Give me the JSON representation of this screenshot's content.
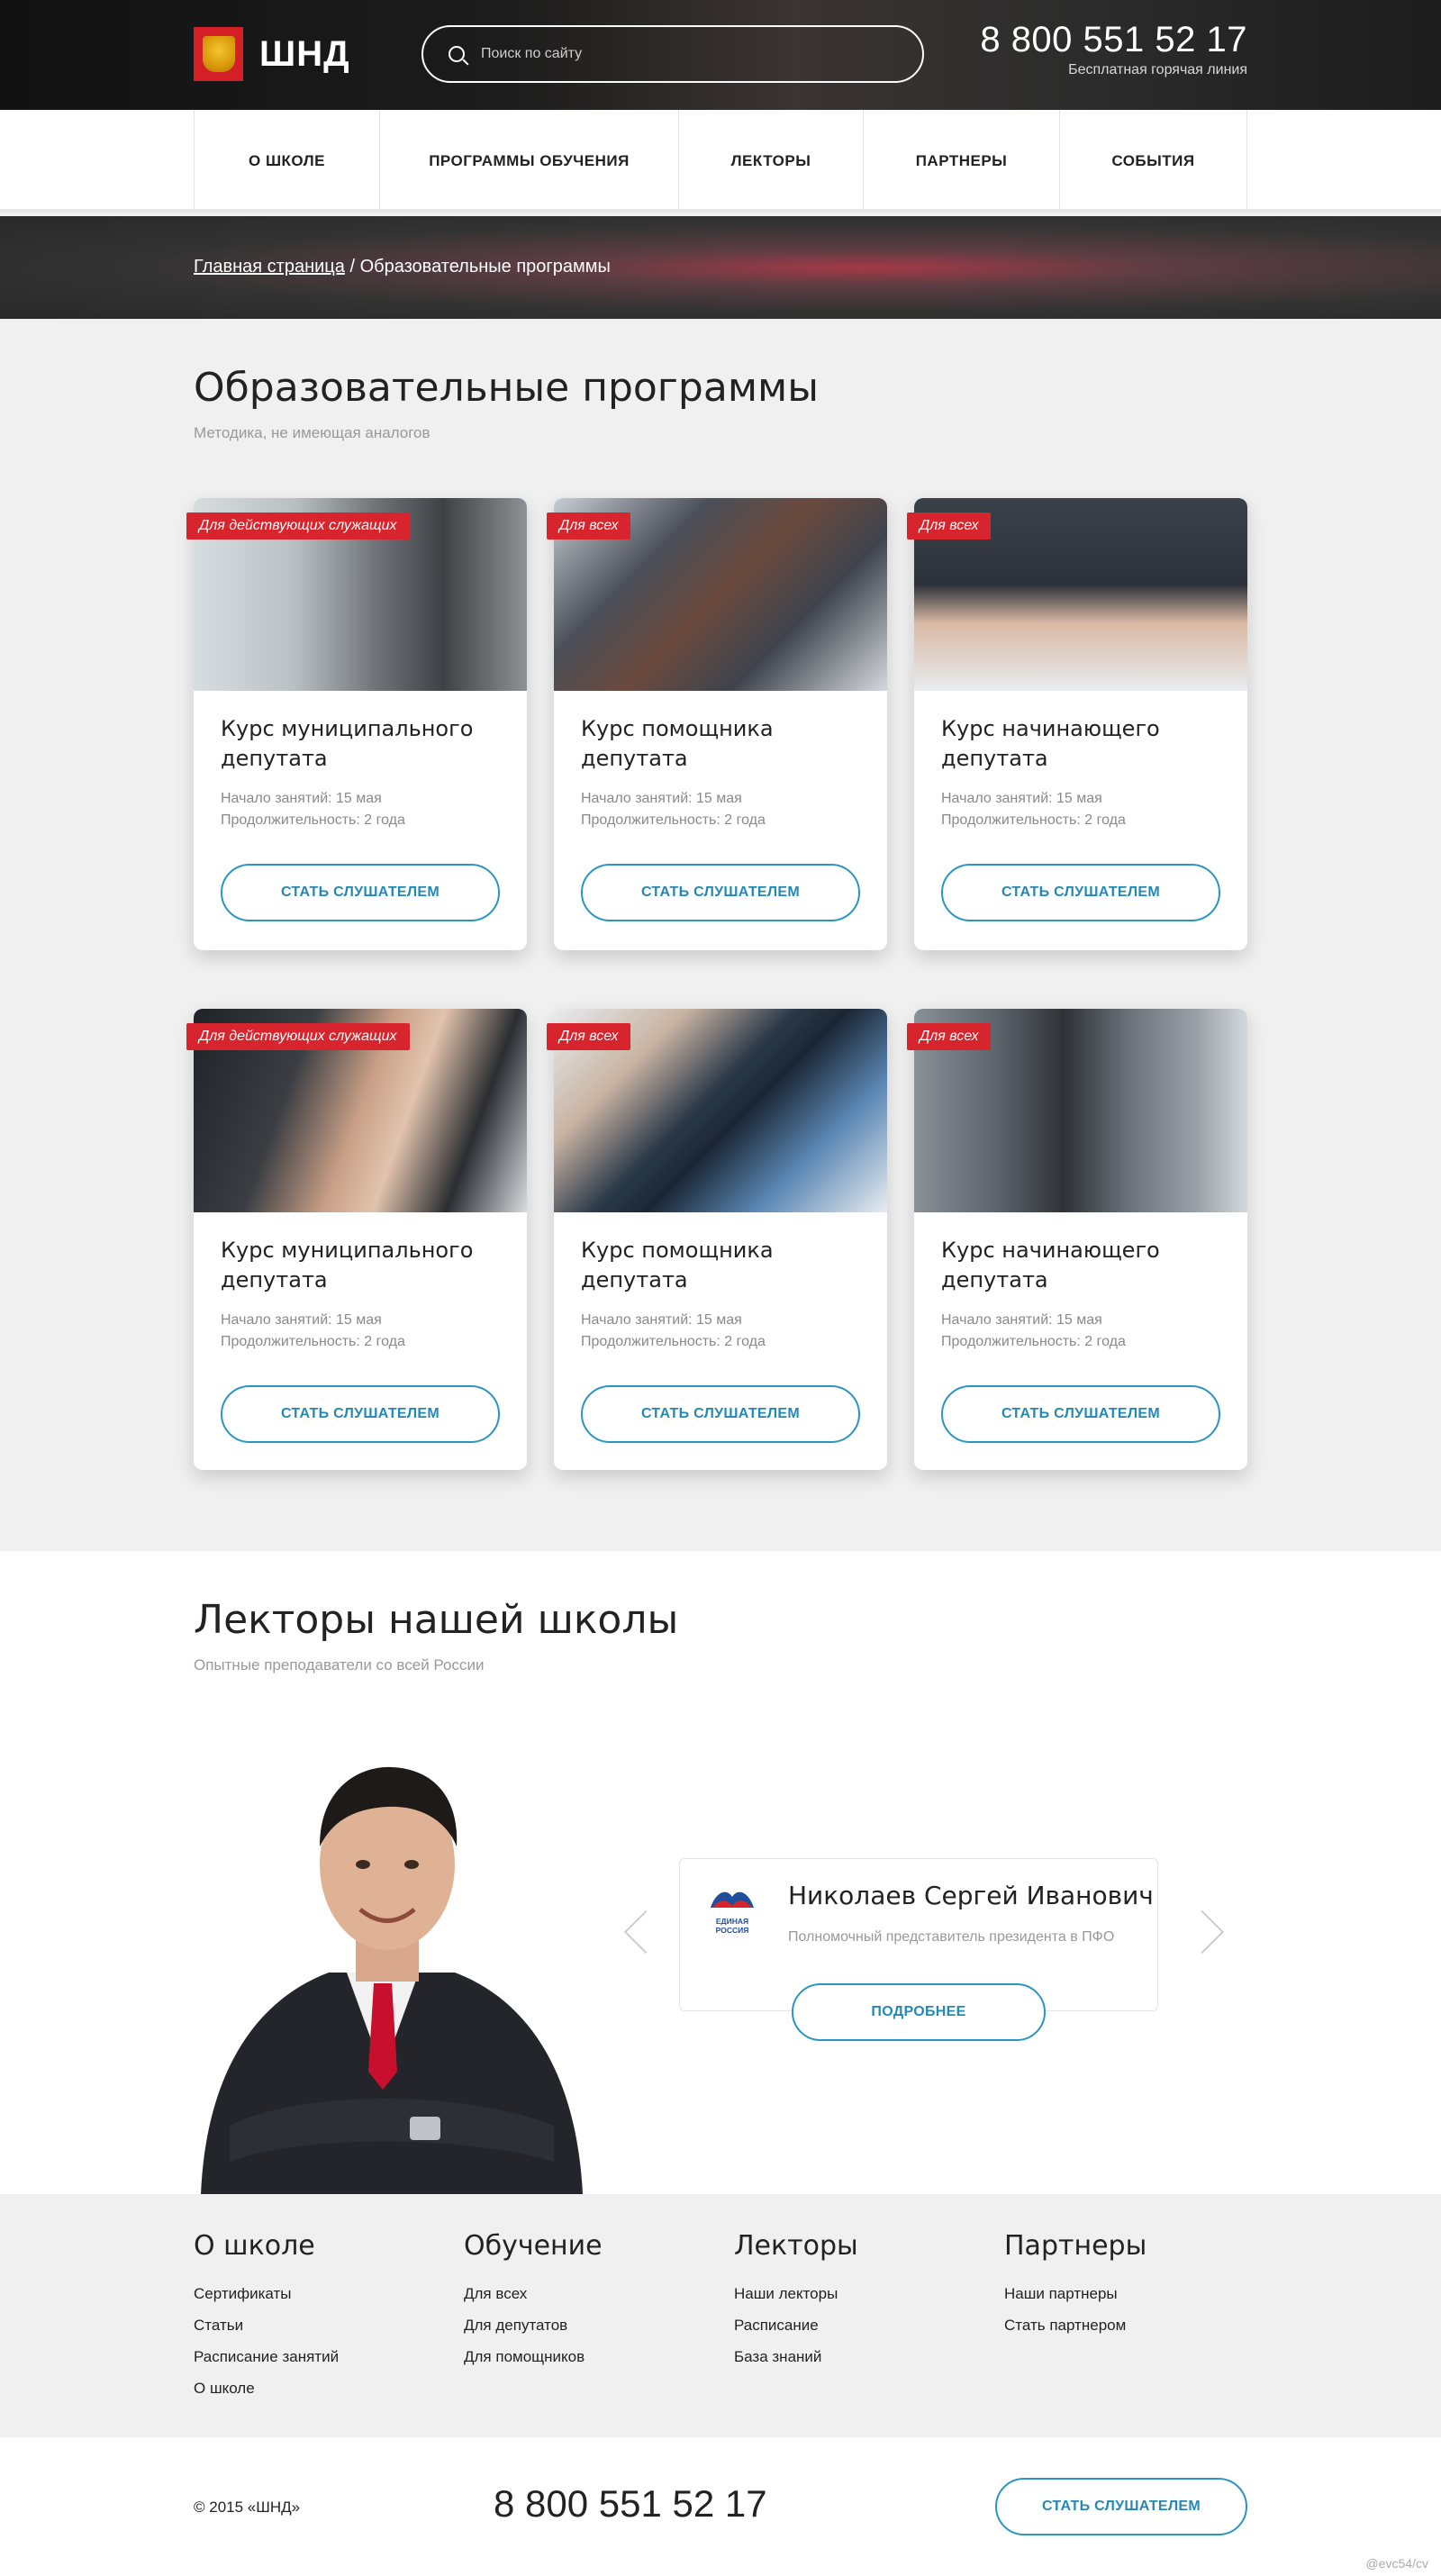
{
  "header": {
    "logo_text": "ШНД",
    "search_placeholder": "Поиск по сайту",
    "phone": "8 800 551 52 17",
    "phone_caption": "Бесплатная горячая линия"
  },
  "nav": {
    "items": [
      "О школе",
      "Программы обучения",
      "Лекторы",
      "Партнеры",
      "События"
    ]
  },
  "breadcrumb": {
    "home": "Главная страница",
    "separator": "/",
    "current": "Образовательные программы"
  },
  "programs": {
    "title": "Образовательные программы",
    "subtitle": "Методика, не имеющая аналогов",
    "cards": [
      {
        "tag": "Для действующих служащих",
        "title": "Курс муниципального депутата",
        "start": "Начало занятий: 15 мая",
        "duration": "Продолжительность: 2 года",
        "button": "Стать слушателем"
      },
      {
        "tag": "Для всех",
        "title": "Курс помощника депутата",
        "start": "Начало занятий: 15 мая",
        "duration": "Продолжительность: 2 года",
        "button": "Стать слушателем"
      },
      {
        "tag": "Для всех",
        "title": "Курс начинающего депутата",
        "start": "Начало занятий: 15 мая",
        "duration": "Продолжительность: 2 года",
        "button": "Стать слушателем"
      },
      {
        "tag": "Для действующих служащих",
        "title": "Курс муниципального депутата",
        "start": "Начало занятий: 15 мая",
        "duration": "Продолжительность: 2 года",
        "button": "Стать слушателем"
      },
      {
        "tag": "Для всех",
        "title": "Курс помощника депутата",
        "start": "Начало занятий: 15 мая",
        "duration": "Продолжительность: 2 года",
        "button": "Стать слушателем"
      },
      {
        "tag": "Для всех",
        "title": "Курс начинающего депутата",
        "start": "Начало занятий: 15 мая",
        "duration": "Продолжительность: 2 года",
        "button": "Стать слушателем"
      }
    ]
  },
  "lecturers": {
    "title": "Лекторы нашей школы",
    "subtitle": "Опытные преподаватели со всей России",
    "current": {
      "name": "Николаев Сергей Иванович",
      "role": "Полномочный представитель президента в ПФО",
      "party_logo_text": "ЕДИНАЯ РОССИЯ",
      "button": "Подробнее"
    }
  },
  "footer": {
    "columns": [
      {
        "title": "О школе",
        "links": [
          "Сертификаты",
          "Статьи",
          "Расписание занятий",
          "О школе"
        ]
      },
      {
        "title": "Обучение",
        "links": [
          "Для всех",
          "Для депутатов",
          "Для помощников"
        ]
      },
      {
        "title": "Лекторы",
        "links": [
          "Наши лекторы",
          "Расписание",
          "База знаний"
        ]
      },
      {
        "title": "Партнеры",
        "links": [
          "Наши партнеры",
          "Стать партнером"
        ]
      }
    ],
    "copyright": "© 2015 «ШНД»",
    "phone": "8 800 551 52 17",
    "button": "Стать слушателем",
    "credit": "@evc54/cv"
  },
  "colors": {
    "accent_red": "#d8242c",
    "accent_blue": "#2b95c0",
    "header_dark": "#1c1c1c"
  }
}
